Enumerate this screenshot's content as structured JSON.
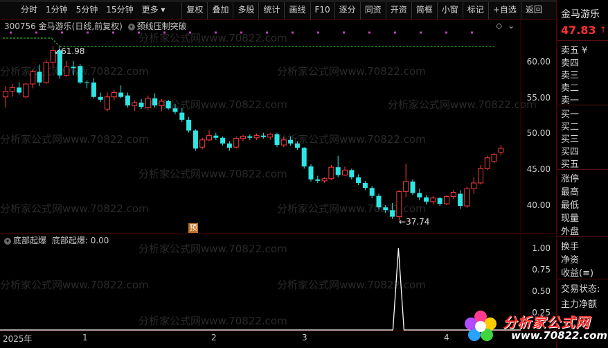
{
  "toolbar": {
    "left_tabs": [
      "分时",
      "1分钟",
      "5分钟",
      "15分钟",
      "更多 ▾"
    ],
    "buttons": [
      "复权",
      "叠加",
      "多股",
      "统计",
      "画线",
      "F10",
      "逐分",
      "同资",
      "开资",
      "简框",
      "小窗",
      "标记",
      "+自选",
      "返回"
    ]
  },
  "main_chart": {
    "code": "300756",
    "name_period": "金马游乐(日线,前复权)",
    "indicator_label": "颈线压制突破",
    "high_label": "61.98",
    "low_label": "37.74",
    "pre_marker": "预",
    "y_ticks": [
      "60.00",
      "55.00",
      "50.00",
      "45.00",
      "40.00"
    ]
  },
  "sub_chart": {
    "indicator_name": "底部起爆",
    "value_label": "底部起爆: 0.00",
    "y_ticks": [
      "1.00",
      "0.75",
      "0.50",
      "0.25"
    ]
  },
  "x_axis": {
    "labels": [
      "2025年",
      "1",
      "2",
      "3",
      "4"
    ]
  },
  "panel": {
    "stock_name": "金马游乐",
    "price": "47.83",
    "price_arrow": "↑",
    "sell_rows": [
      "卖五 ¥",
      "卖四",
      "卖三",
      "卖二",
      "卖一"
    ],
    "buy_rows": [
      "买一",
      "买二",
      "买三",
      "买四",
      "买五"
    ],
    "stats_rows": [
      "涨停",
      "最高",
      "最低",
      "现量",
      "外盘"
    ],
    "flow_rows": [
      "换手",
      "净资",
      "收益(≡)"
    ],
    "status_rows": [
      "交易状态:",
      "主力净额"
    ]
  },
  "watermark": "分析家公式网www.70822.com",
  "logo": {
    "text": "分析家公式网",
    "url": "www.70822.com"
  },
  "colors": {
    "up": "#ff3c3c",
    "down": "#2ee6e6",
    "accent": "#ff2020",
    "grid": "#500000",
    "dashed": "#39d339"
  },
  "chart_data": [
    {
      "type": "candlestick",
      "title": "金马游乐(日线,前复权)",
      "x_labels": [
        "2025年",
        "1",
        "2",
        "3",
        "4"
      ],
      "ylim": [
        37,
        63
      ],
      "y_ticks": [
        40,
        45,
        50,
        55,
        60
      ],
      "candles": [
        {
          "o": 55.0,
          "h": 56.5,
          "l": 53.5,
          "c": 55.8
        },
        {
          "o": 55.8,
          "h": 56.8,
          "l": 55.0,
          "c": 56.3
        },
        {
          "o": 56.3,
          "h": 57.0,
          "l": 55.3,
          "c": 55.6
        },
        {
          "o": 55.0,
          "h": 57.0,
          "l": 54.8,
          "c": 56.8
        },
        {
          "o": 56.8,
          "h": 58.8,
          "l": 56.2,
          "c": 58.5
        },
        {
          "o": 58.5,
          "h": 59.5,
          "l": 56.5,
          "c": 57.0
        },
        {
          "o": 57.0,
          "h": 60.2,
          "l": 56.8,
          "c": 59.8
        },
        {
          "o": 59.8,
          "h": 62.0,
          "l": 59.0,
          "c": 61.5
        },
        {
          "o": 61.5,
          "h": 61.98,
          "l": 57.5,
          "c": 58.0
        },
        {
          "o": 58.0,
          "h": 60.0,
          "l": 57.8,
          "c": 59.2
        },
        {
          "o": 59.2,
          "h": 60.0,
          "l": 58.0,
          "c": 59.0
        },
        {
          "o": 59.3,
          "h": 59.6,
          "l": 56.8,
          "c": 57.0
        },
        {
          "o": 57.0,
          "h": 57.3,
          "l": 56.2,
          "c": 56.9
        },
        {
          "o": 57.0,
          "h": 57.6,
          "l": 54.8,
          "c": 55.0
        },
        {
          "o": 55.0,
          "h": 55.6,
          "l": 54.3,
          "c": 54.6
        },
        {
          "o": 53.3,
          "h": 55.6,
          "l": 53.0,
          "c": 55.0
        },
        {
          "o": 55.0,
          "h": 56.0,
          "l": 54.5,
          "c": 55.6
        },
        {
          "o": 55.6,
          "h": 56.6,
          "l": 54.8,
          "c": 55.0
        },
        {
          "o": 55.2,
          "h": 55.6,
          "l": 53.5,
          "c": 53.8
        },
        {
          "o": 53.8,
          "h": 54.5,
          "l": 53.0,
          "c": 54.2
        },
        {
          "o": 54.2,
          "h": 54.7,
          "l": 53.3,
          "c": 53.6
        },
        {
          "o": 53.5,
          "h": 55.2,
          "l": 53.2,
          "c": 54.8
        },
        {
          "o": 54.8,
          "h": 55.5,
          "l": 53.5,
          "c": 53.8
        },
        {
          "o": 53.8,
          "h": 54.7,
          "l": 53.0,
          "c": 54.4
        },
        {
          "o": 54.4,
          "h": 54.6,
          "l": 53.2,
          "c": 53.4
        },
        {
          "o": 53.4,
          "h": 54.0,
          "l": 52.6,
          "c": 52.9
        },
        {
          "o": 52.8,
          "h": 53.4,
          "l": 51.5,
          "c": 51.8
        },
        {
          "o": 51.8,
          "h": 52.2,
          "l": 50.0,
          "c": 50.3
        },
        {
          "o": 50.3,
          "h": 50.5,
          "l": 47.5,
          "c": 47.8
        },
        {
          "o": 48.0,
          "h": 49.3,
          "l": 47.7,
          "c": 49.0
        },
        {
          "o": 49.0,
          "h": 50.4,
          "l": 48.8,
          "c": 49.6
        },
        {
          "o": 49.6,
          "h": 50.0,
          "l": 49.0,
          "c": 49.3
        },
        {
          "o": 49.3,
          "h": 49.5,
          "l": 48.2,
          "c": 48.5
        },
        {
          "o": 48.5,
          "h": 48.8,
          "l": 47.5,
          "c": 47.9
        },
        {
          "o": 48.0,
          "h": 49.5,
          "l": 47.8,
          "c": 49.2
        },
        {
          "o": 49.2,
          "h": 49.7,
          "l": 48.8,
          "c": 49.5
        },
        {
          "o": 49.5,
          "h": 49.8,
          "l": 49.0,
          "c": 49.3
        },
        {
          "o": 49.3,
          "h": 49.9,
          "l": 49.0,
          "c": 49.6
        },
        {
          "o": 49.6,
          "h": 50.0,
          "l": 49.2,
          "c": 49.4
        },
        {
          "o": 49.4,
          "h": 50.0,
          "l": 49.0,
          "c": 49.8
        },
        {
          "o": 49.8,
          "h": 50.0,
          "l": 48.0,
          "c": 48.3
        },
        {
          "o": 48.3,
          "h": 49.5,
          "l": 48.0,
          "c": 49.0
        },
        {
          "o": 49.0,
          "h": 49.5,
          "l": 48.2,
          "c": 48.5
        },
        {
          "o": 48.5,
          "h": 48.8,
          "l": 47.6,
          "c": 47.9
        },
        {
          "o": 47.9,
          "h": 48.0,
          "l": 45.0,
          "c": 45.3
        },
        {
          "o": 45.3,
          "h": 45.6,
          "l": 43.2,
          "c": 43.5
        },
        {
          "o": 43.5,
          "h": 44.0,
          "l": 43.0,
          "c": 43.3
        },
        {
          "o": 43.3,
          "h": 43.8,
          "l": 43.0,
          "c": 43.6
        },
        {
          "o": 43.6,
          "h": 45.5,
          "l": 43.4,
          "c": 45.2
        },
        {
          "o": 45.2,
          "h": 46.8,
          "l": 43.8,
          "c": 44.1
        },
        {
          "o": 44.1,
          "h": 45.3,
          "l": 44.0,
          "c": 44.8
        },
        {
          "o": 44.8,
          "h": 45.0,
          "l": 43.5,
          "c": 43.8
        },
        {
          "o": 43.8,
          "h": 44.2,
          "l": 42.7,
          "c": 43.0
        },
        {
          "o": 43.0,
          "h": 43.3,
          "l": 42.0,
          "c": 42.3
        },
        {
          "o": 42.3,
          "h": 42.6,
          "l": 40.9,
          "c": 41.2
        },
        {
          "o": 41.2,
          "h": 41.5,
          "l": 39.3,
          "c": 39.6
        },
        {
          "o": 39.6,
          "h": 39.9,
          "l": 38.8,
          "c": 39.2
        },
        {
          "o": 39.2,
          "h": 40.2,
          "l": 38.0,
          "c": 38.3
        },
        {
          "o": 38.3,
          "h": 42.0,
          "l": 37.74,
          "c": 41.8
        },
        {
          "o": 41.8,
          "h": 45.7,
          "l": 41.0,
          "c": 43.2
        },
        {
          "o": 43.2,
          "h": 43.5,
          "l": 41.3,
          "c": 41.6
        },
        {
          "o": 41.6,
          "h": 42.2,
          "l": 40.6,
          "c": 41.0
        },
        {
          "o": 41.0,
          "h": 41.3,
          "l": 40.0,
          "c": 40.4
        },
        {
          "o": 40.4,
          "h": 41.2,
          "l": 40.0,
          "c": 40.9
        },
        {
          "o": 40.9,
          "h": 41.0,
          "l": 39.8,
          "c": 40.1
        },
        {
          "o": 40.1,
          "h": 41.3,
          "l": 39.9,
          "c": 41.1
        },
        {
          "o": 41.1,
          "h": 42.0,
          "l": 40.8,
          "c": 41.7
        },
        {
          "o": 41.5,
          "h": 42.0,
          "l": 39.4,
          "c": 39.8
        },
        {
          "o": 39.8,
          "h": 42.5,
          "l": 39.5,
          "c": 42.2
        },
        {
          "o": 42.2,
          "h": 43.8,
          "l": 41.5,
          "c": 43.0
        },
        {
          "o": 43.0,
          "h": 45.5,
          "l": 42.8,
          "c": 45.0
        },
        {
          "o": 45.0,
          "h": 46.8,
          "l": 44.8,
          "c": 46.5
        },
        {
          "o": 46.0,
          "h": 47.2,
          "l": 45.8,
          "c": 47.0
        },
        {
          "o": 47.3,
          "h": 48.3,
          "l": 46.8,
          "c": 47.83
        }
      ],
      "annotations": [
        "61.98",
        "37.74",
        "预"
      ]
    },
    {
      "type": "line",
      "title": "底部起爆",
      "ylim": [
        0,
        1
      ],
      "y_ticks": [
        0.25,
        0.5,
        0.75,
        1.0
      ],
      "spike_index": 58,
      "value_at_spike": 1.0,
      "values_otherwise": 0
    }
  ]
}
